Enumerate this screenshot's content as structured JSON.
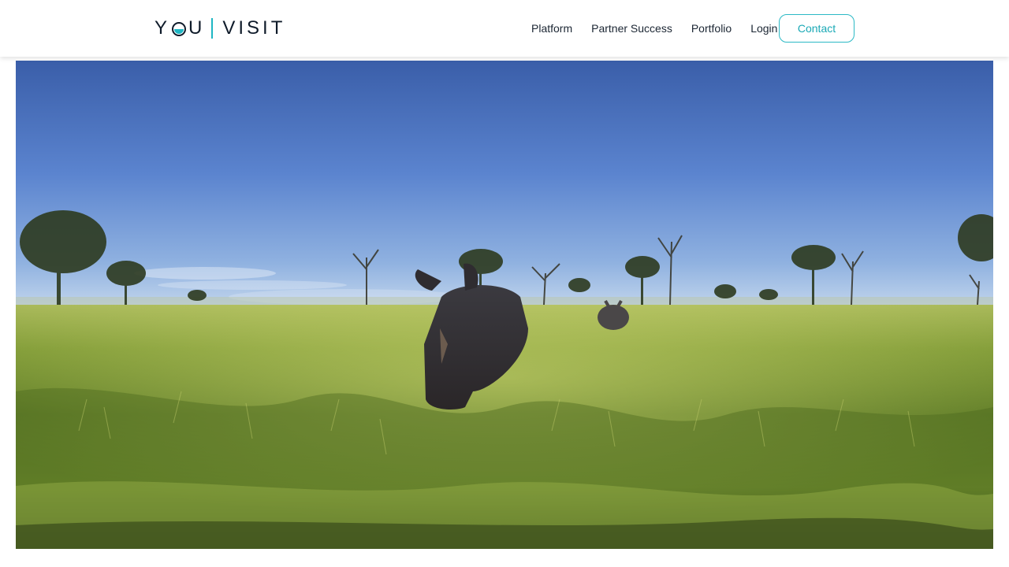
{
  "header": {
    "logo": {
      "left_word": "Y",
      "left_word_end": "U",
      "right_word": "VISIT",
      "accent_color": "#1fb7c4"
    },
    "nav": [
      {
        "label": "Platform"
      },
      {
        "label": "Partner Success"
      },
      {
        "label": "Portfolio"
      },
      {
        "label": "Login"
      }
    ],
    "contact_label": "Contact"
  },
  "hero": {
    "scene": "360 panorama of rhinos in savanna grassland",
    "colors": {
      "sky_top": "#3e63b0",
      "sky_horizon": "#9fbde2",
      "grass_light": "#9bb84a",
      "grass_dark": "#34461a"
    }
  }
}
